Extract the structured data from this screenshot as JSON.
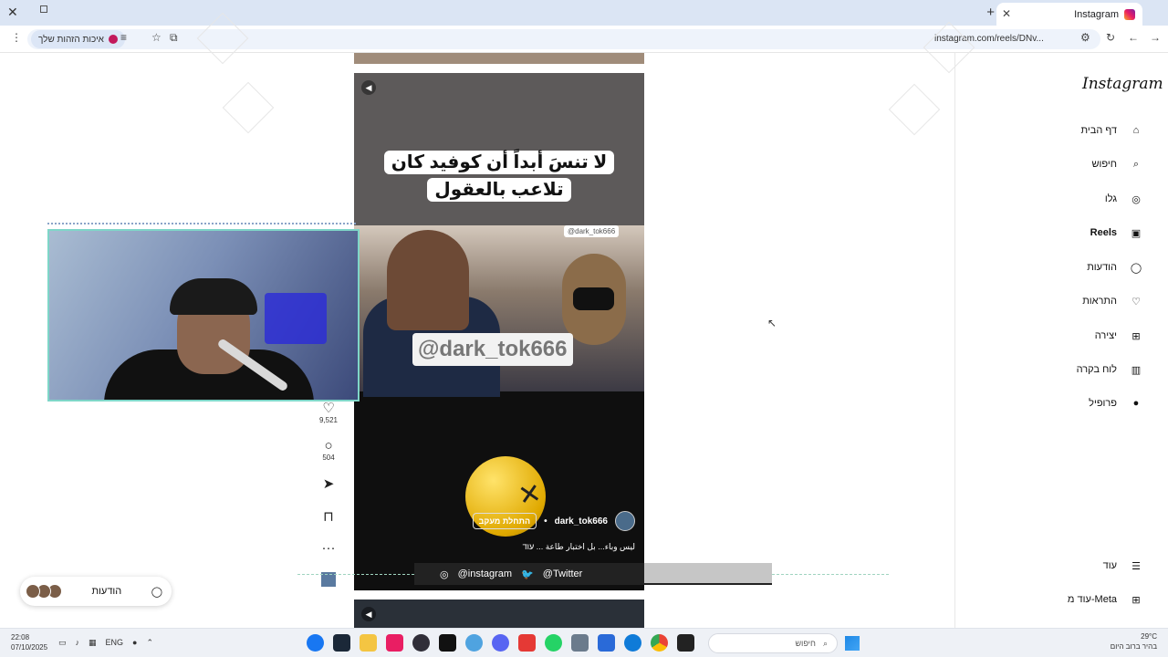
{
  "browser": {
    "tab_title": "Instagram",
    "url": "instagram.com/reels/DNv...",
    "profile_chip": "איכות הזהות שלך",
    "colors": {
      "tabstrip": "#dbe5f4",
      "chip": "#dce6f6"
    }
  },
  "instagram": {
    "logo": "Instagram",
    "nav": [
      {
        "label": "דף הבית",
        "icon": "home-icon",
        "glyph": "⌂"
      },
      {
        "label": "חיפוש",
        "icon": "search-icon",
        "glyph": "⌕"
      },
      {
        "label": "גלו",
        "icon": "compass-icon",
        "glyph": "◎"
      },
      {
        "label": "Reels",
        "icon": "reels-icon",
        "glyph": "▣"
      },
      {
        "label": "הודעות",
        "icon": "messenger-icon",
        "glyph": "◯"
      },
      {
        "label": "התראות",
        "icon": "heart-icon",
        "glyph": "♡"
      },
      {
        "label": "יצירה",
        "icon": "plus-square-icon",
        "glyph": "⊞"
      },
      {
        "label": "לוח בקרה",
        "icon": "chart-icon",
        "glyph": "▥"
      },
      {
        "label": "פרופיל",
        "icon": "avatar-icon",
        "glyph": "●"
      }
    ],
    "more": "עוד",
    "meta": "עוד מ-Meta",
    "messages": "הודעות"
  },
  "reel": {
    "caption": "لا تنسَ أبداً أن كوفيد كان تلاعب بالعقول",
    "watermark_small": "@dark_tok666",
    "watermark_big": "@dark_tok666",
    "author": "dark_tok666",
    "follow": "התחלת מעקב",
    "description": "ليس وباء... بل اختبار طاعة ... עוד",
    "likes": "9,521",
    "comments": "504"
  },
  "stream": {
    "social_instagram": "@instagram",
    "social_twitter": "@Twitter"
  },
  "taskbar": {
    "time": "22:08",
    "date": "07/10/2025",
    "lang": "ENG",
    "search": "חיפוש",
    "weather_temp": "29°C",
    "weather_desc": "בהיר ברוב היום"
  }
}
